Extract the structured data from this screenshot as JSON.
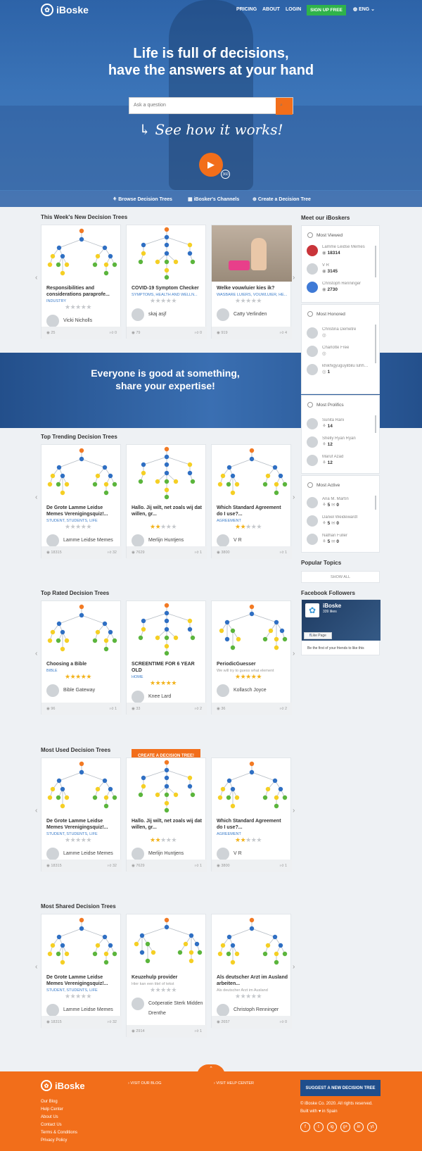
{
  "header": {
    "brand": "iBoske",
    "nav": [
      "PRICING",
      "ABOUT",
      "LOGIN"
    ],
    "signup": "SIGN UP FREE",
    "language": "ENG",
    "headline1": "Life is full of decisions,",
    "headline2": "have the answers at your hand",
    "search_placeholder": "Ask a question",
    "how_it_works": "See how it works!",
    "badge_360": "360",
    "subnav": [
      "Browse Decision Trees",
      "iBosker's Channels",
      "Create a Decision Tree"
    ]
  },
  "sections": [
    {
      "title": "This Week's New Decision Trees",
      "cards": [
        {
          "title": "Responsibilities and considerations paraprofe...",
          "category": "INDUSTRY",
          "author": "Vicki Nicholls",
          "views": "25",
          "likes": "0",
          "rating": 0
        },
        {
          "title": "COVID-19 Symptom Checker",
          "category": "SYMPTOMS, HEALTH AND WELLN...",
          "author": "skaj asjf",
          "views": "79",
          "likes": "0",
          "rating": 0
        },
        {
          "title": "Welke vouwluier kies ik?",
          "category": "WASBARE LUIERS, VOUWLUIER, HE...",
          "author": "Catty Verlinden",
          "views": "919",
          "likes": "4",
          "rating": 0
        }
      ]
    },
    {
      "title": "Top Trending Decision Trees",
      "cards": [
        {
          "title": "De Grote Lamme Leidse Memes Verenigingsquiz!...",
          "category": "STUDENT, STUDENTS, LIFE",
          "author": "Lamme Leidse Memes",
          "views": "18315",
          "likes": "32",
          "rating": 0
        },
        {
          "title": "Hallo. Jij wilt, net zoals wij dat willen, gr...",
          "category": "",
          "author": "Merlijn Huntjens",
          "views": "7629",
          "likes": "1",
          "rating": 2
        },
        {
          "title": "Which Standard Agreement do I use?...",
          "category": "AGREEMENT",
          "author": "V R",
          "views": "3800",
          "likes": "1",
          "rating": 2
        }
      ]
    },
    {
      "title": "Top Rated Decision Trees",
      "cards": [
        {
          "title": "Choosing a Bible",
          "category": "BIBLE",
          "author": "Bible Gateway",
          "views": "96",
          "likes": "1",
          "rating": 5
        },
        {
          "title": "SCREENTIME FOR 6 YEAR OLD",
          "category": "HOME",
          "author": "Knee Lard",
          "views": "33",
          "likes": "2",
          "rating": 5
        },
        {
          "title": "PeriodicGuesser",
          "category": "We will try to guess what element",
          "author": "Kollasch Joyce",
          "views": "36",
          "likes": "2",
          "rating": 5
        }
      ]
    },
    {
      "title": "Most Used Decision Trees",
      "cards": [
        {
          "title": "De Grote Lamme Leidse Memes Verenigingsquiz!...",
          "category": "STUDENT, STUDENTS, LIFE",
          "author": "Lamme Leidse Memes",
          "views": "18315",
          "likes": "32",
          "rating": 0
        },
        {
          "title": "Hallo. Jij wilt, net zoals wij dat willen, gr...",
          "category": "",
          "author": "Merlijn Huntjens",
          "views": "7629",
          "likes": "1",
          "rating": 2
        },
        {
          "title": "Which Standard Agreement do I use?...",
          "category": "AGREEMENT",
          "author": "V R",
          "views": "3800",
          "likes": "1",
          "rating": 2
        }
      ]
    },
    {
      "title": "Most Shared Decision Trees",
      "cards": [
        {
          "title": "De Grote Lamme Leidse Memes Verenigingsquiz!...",
          "category": "STUDENT, STUDENTS, LIFE",
          "author": "Lamme Leidse Memes",
          "views": "18315",
          "likes": "32",
          "rating": 0
        },
        {
          "title": "Keuzehulp provider",
          "category": "Hier kan een titel of tekst",
          "author": "Coöperatie Sterk Midden Drenthe",
          "views": "2914",
          "likes": "1",
          "rating": 0
        },
        {
          "title": "Als deutscher Arzt im Ausland arbeiten...",
          "category": "Als deutscher Arzt im Ausland",
          "author": "Christoph Renninger",
          "views": "2657",
          "likes": "0",
          "rating": 0
        }
      ]
    }
  ],
  "banner": {
    "line1": "Everyone is good at something,",
    "line2": "share your expertise!",
    "button": "CREATE A DECISION TREE!"
  },
  "sidebar": {
    "title": "Meet our iBoskers",
    "most_viewed": {
      "label": "Most Viewed",
      "items": [
        {
          "name": "Lamme Leidse Memes",
          "value": "18314"
        },
        {
          "name": "V R",
          "value": "3145"
        },
        {
          "name": "Christoph Renninger",
          "value": "2730"
        }
      ]
    },
    "most_honored": {
      "label": "Most Honored",
      "items": [
        {
          "name": "Christina Demetre",
          "value": ""
        },
        {
          "name": "Charlotte Free",
          "value": ""
        },
        {
          "name": "khikhigyuguyilbilu luhhuguyfuyfuyfuktf.u",
          "value": "1"
        }
      ]
    },
    "most_prolific": {
      "label": "Most Prolifics",
      "items": [
        {
          "name": "Sunita Rani",
          "value": "14"
        },
        {
          "name": "Shelly Ryan Ryan",
          "value": "12"
        },
        {
          "name": "Maruf Azad",
          "value": "12"
        }
      ]
    },
    "most_active": {
      "label": "Most Active",
      "items": [
        {
          "name": "Ana M. Martín",
          "value": "5",
          "value2": "0"
        },
        {
          "name": "Daniel Weidewardt",
          "value": "5",
          "value2": "0"
        },
        {
          "name": "Nathan Fuller",
          "value": "5",
          "value2": "0"
        }
      ]
    },
    "popular_topics": "Popular Topics",
    "show_all": "SHOW ALL",
    "facebook": {
      "title": "Facebook Followers",
      "page": "iBoske",
      "likes": "339 likes",
      "like_button": "Like Page",
      "text": "Be the first of your friends to like this"
    }
  },
  "footer": {
    "brand": "iBoske",
    "links": [
      "Our Blog",
      "Help Center",
      "About Us",
      "Contact Us",
      "Terms & Conditions",
      "Privacy Policy"
    ],
    "visit_blog": "VISIT OUR BLOG",
    "visit_help": "VISIT HELP CENTER",
    "suggest": "SUGGEST A NEW DECISION TREE",
    "copyright": "© iBoske Co. 2020. All rights reserved.",
    "built": "Built with",
    "built2": "in Spain",
    "social": [
      "f",
      "t",
      "ig",
      "g+",
      "in",
      "yt"
    ]
  },
  "colors": {
    "brand_blue": "#2d63a8",
    "accent_orange": "#f26e1a",
    "signup_green": "#2fb34a",
    "star": "#f2b21a"
  }
}
